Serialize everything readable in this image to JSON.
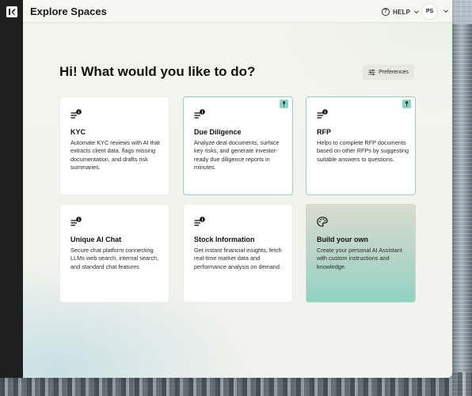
{
  "header": {
    "app_title": "Explore Spaces",
    "help_label": "HELP",
    "user_initials": "PS"
  },
  "main": {
    "greeting": "Hi! What would you like to do?",
    "preferences_label": "Preferences"
  },
  "cards": [
    {
      "title": "KYC",
      "description": "Automate KYC reviews with AI that extracts client data, flags missing documentation, and drafts risk summaries.",
      "pinned": false,
      "icon": "document-info-icon"
    },
    {
      "title": "Due Diligence",
      "description": "Analyze deal documents, surface key risks, and generate investor-ready due diligence reports in minutes.",
      "pinned": true,
      "icon": "document-info-icon"
    },
    {
      "title": "RFP",
      "description": "Helps to complete RFP documents based on other RFPs by suggesting suitable answers to questions.",
      "pinned": true,
      "icon": "document-info-icon"
    },
    {
      "title": "Unique AI Chat",
      "description": "Secure chat platform connecting LLMs web search, internal search, and standard chat features",
      "pinned": false,
      "icon": "document-info-icon"
    },
    {
      "title": "Stock Information",
      "description": "Get instant financial insights, fetch real-time market data and performance analysis on demand.",
      "pinned": false,
      "icon": "document-info-icon"
    },
    {
      "title": "Build your own",
      "description": "Create your personal AI Assistant with custom instructions and knowledge.",
      "pinned": false,
      "icon": "palette-icon"
    }
  ],
  "colors": {
    "accent": "#8fd1c4",
    "sidebar": "#1f1f1f",
    "pinned_border": "#9bcfc6"
  }
}
